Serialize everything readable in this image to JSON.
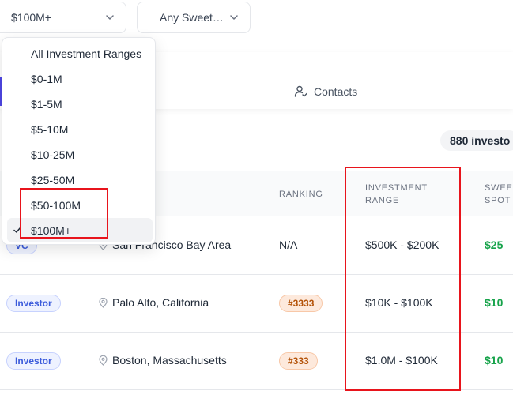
{
  "filters": {
    "range_value": "$100M+",
    "sweet_value": "Any Sweet…"
  },
  "tabs": {
    "contacts_label": "Contacts"
  },
  "results": {
    "count_text": "880 investo"
  },
  "table": {
    "headers": {
      "ranking": "RANKING",
      "investment_range_line1": "INVESTMENT",
      "investment_range_line2": "RANGE",
      "sweet_spot_line1": "SWEE",
      "sweet_spot_line2": "SPOT"
    },
    "rows": [
      {
        "type": "VC",
        "location": "San Francisco Bay Area",
        "ranking": "N/A",
        "range": "$500K - $200K",
        "sweet_spot": "$25"
      },
      {
        "type": "Investor",
        "location": "Palo Alto, California",
        "ranking": "#3333",
        "range": "$10K - $100K",
        "sweet_spot": "$10"
      },
      {
        "type": "Investor",
        "location": "Boston, Massachusetts",
        "ranking": "#333",
        "range": "$1.0M - $100K",
        "sweet_spot": "$10"
      }
    ]
  },
  "dropdown": {
    "options": [
      "All Investment Ranges",
      "$0-1M",
      "$1-5M",
      "$5-10M",
      "$10-25M",
      "$25-50M",
      "$50-100M",
      "$100M+"
    ],
    "selected": "$100M+"
  },
  "colors": {
    "highlight": "#e8141c",
    "badge_text": "#3b5bdb",
    "sweet_spot": "#16a34a",
    "rank_text": "#b45309"
  }
}
